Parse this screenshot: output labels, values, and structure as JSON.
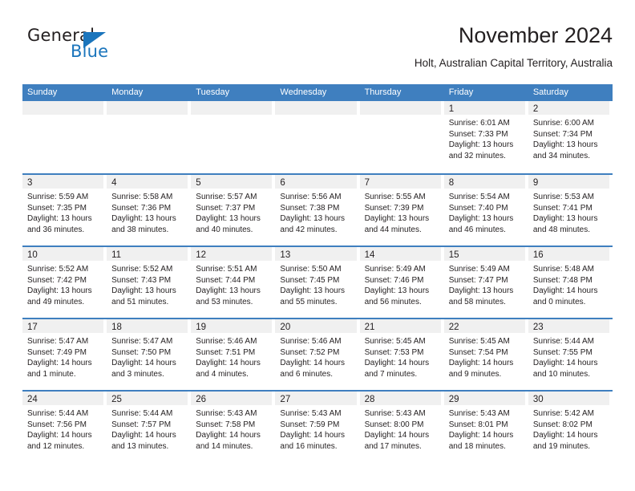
{
  "brand": {
    "name_top": "General",
    "name_bottom": "Blue",
    "color_primary": "#1b75bc",
    "color_text": "#231f20"
  },
  "header": {
    "title": "November 2024",
    "subtitle": "Holt, Australian Capital Territory, Australia"
  },
  "calendar": {
    "header_bg": "#3f7fbf",
    "daynum_bg": "#f0f0f0",
    "weekdays": [
      "Sunday",
      "Monday",
      "Tuesday",
      "Wednesday",
      "Thursday",
      "Friday",
      "Saturday"
    ],
    "weeks": [
      [
        {
          "day": "",
          "empty": true
        },
        {
          "day": "",
          "empty": true
        },
        {
          "day": "",
          "empty": true
        },
        {
          "day": "",
          "empty": true
        },
        {
          "day": "",
          "empty": true
        },
        {
          "day": "1",
          "sunrise": "Sunrise: 6:01 AM",
          "sunset": "Sunset: 7:33 PM",
          "daylight": "Daylight: 13 hours and 32 minutes."
        },
        {
          "day": "2",
          "sunrise": "Sunrise: 6:00 AM",
          "sunset": "Sunset: 7:34 PM",
          "daylight": "Daylight: 13 hours and 34 minutes."
        }
      ],
      [
        {
          "day": "3",
          "sunrise": "Sunrise: 5:59 AM",
          "sunset": "Sunset: 7:35 PM",
          "daylight": "Daylight: 13 hours and 36 minutes."
        },
        {
          "day": "4",
          "sunrise": "Sunrise: 5:58 AM",
          "sunset": "Sunset: 7:36 PM",
          "daylight": "Daylight: 13 hours and 38 minutes."
        },
        {
          "day": "5",
          "sunrise": "Sunrise: 5:57 AM",
          "sunset": "Sunset: 7:37 PM",
          "daylight": "Daylight: 13 hours and 40 minutes."
        },
        {
          "day": "6",
          "sunrise": "Sunrise: 5:56 AM",
          "sunset": "Sunset: 7:38 PM",
          "daylight": "Daylight: 13 hours and 42 minutes."
        },
        {
          "day": "7",
          "sunrise": "Sunrise: 5:55 AM",
          "sunset": "Sunset: 7:39 PM",
          "daylight": "Daylight: 13 hours and 44 minutes."
        },
        {
          "day": "8",
          "sunrise": "Sunrise: 5:54 AM",
          "sunset": "Sunset: 7:40 PM",
          "daylight": "Daylight: 13 hours and 46 minutes."
        },
        {
          "day": "9",
          "sunrise": "Sunrise: 5:53 AM",
          "sunset": "Sunset: 7:41 PM",
          "daylight": "Daylight: 13 hours and 48 minutes."
        }
      ],
      [
        {
          "day": "10",
          "sunrise": "Sunrise: 5:52 AM",
          "sunset": "Sunset: 7:42 PM",
          "daylight": "Daylight: 13 hours and 49 minutes."
        },
        {
          "day": "11",
          "sunrise": "Sunrise: 5:52 AM",
          "sunset": "Sunset: 7:43 PM",
          "daylight": "Daylight: 13 hours and 51 minutes."
        },
        {
          "day": "12",
          "sunrise": "Sunrise: 5:51 AM",
          "sunset": "Sunset: 7:44 PM",
          "daylight": "Daylight: 13 hours and 53 minutes."
        },
        {
          "day": "13",
          "sunrise": "Sunrise: 5:50 AM",
          "sunset": "Sunset: 7:45 PM",
          "daylight": "Daylight: 13 hours and 55 minutes."
        },
        {
          "day": "14",
          "sunrise": "Sunrise: 5:49 AM",
          "sunset": "Sunset: 7:46 PM",
          "daylight": "Daylight: 13 hours and 56 minutes."
        },
        {
          "day": "15",
          "sunrise": "Sunrise: 5:49 AM",
          "sunset": "Sunset: 7:47 PM",
          "daylight": "Daylight: 13 hours and 58 minutes."
        },
        {
          "day": "16",
          "sunrise": "Sunrise: 5:48 AM",
          "sunset": "Sunset: 7:48 PM",
          "daylight": "Daylight: 14 hours and 0 minutes."
        }
      ],
      [
        {
          "day": "17",
          "sunrise": "Sunrise: 5:47 AM",
          "sunset": "Sunset: 7:49 PM",
          "daylight": "Daylight: 14 hours and 1 minute."
        },
        {
          "day": "18",
          "sunrise": "Sunrise: 5:47 AM",
          "sunset": "Sunset: 7:50 PM",
          "daylight": "Daylight: 14 hours and 3 minutes."
        },
        {
          "day": "19",
          "sunrise": "Sunrise: 5:46 AM",
          "sunset": "Sunset: 7:51 PM",
          "daylight": "Daylight: 14 hours and 4 minutes."
        },
        {
          "day": "20",
          "sunrise": "Sunrise: 5:46 AM",
          "sunset": "Sunset: 7:52 PM",
          "daylight": "Daylight: 14 hours and 6 minutes."
        },
        {
          "day": "21",
          "sunrise": "Sunrise: 5:45 AM",
          "sunset": "Sunset: 7:53 PM",
          "daylight": "Daylight: 14 hours and 7 minutes."
        },
        {
          "day": "22",
          "sunrise": "Sunrise: 5:45 AM",
          "sunset": "Sunset: 7:54 PM",
          "daylight": "Daylight: 14 hours and 9 minutes."
        },
        {
          "day": "23",
          "sunrise": "Sunrise: 5:44 AM",
          "sunset": "Sunset: 7:55 PM",
          "daylight": "Daylight: 14 hours and 10 minutes."
        }
      ],
      [
        {
          "day": "24",
          "sunrise": "Sunrise: 5:44 AM",
          "sunset": "Sunset: 7:56 PM",
          "daylight": "Daylight: 14 hours and 12 minutes."
        },
        {
          "day": "25",
          "sunrise": "Sunrise: 5:44 AM",
          "sunset": "Sunset: 7:57 PM",
          "daylight": "Daylight: 14 hours and 13 minutes."
        },
        {
          "day": "26",
          "sunrise": "Sunrise: 5:43 AM",
          "sunset": "Sunset: 7:58 PM",
          "daylight": "Daylight: 14 hours and 14 minutes."
        },
        {
          "day": "27",
          "sunrise": "Sunrise: 5:43 AM",
          "sunset": "Sunset: 7:59 PM",
          "daylight": "Daylight: 14 hours and 16 minutes."
        },
        {
          "day": "28",
          "sunrise": "Sunrise: 5:43 AM",
          "sunset": "Sunset: 8:00 PM",
          "daylight": "Daylight: 14 hours and 17 minutes."
        },
        {
          "day": "29",
          "sunrise": "Sunrise: 5:43 AM",
          "sunset": "Sunset: 8:01 PM",
          "daylight": "Daylight: 14 hours and 18 minutes."
        },
        {
          "day": "30",
          "sunrise": "Sunrise: 5:42 AM",
          "sunset": "Sunset: 8:02 PM",
          "daylight": "Daylight: 14 hours and 19 minutes."
        }
      ]
    ]
  }
}
